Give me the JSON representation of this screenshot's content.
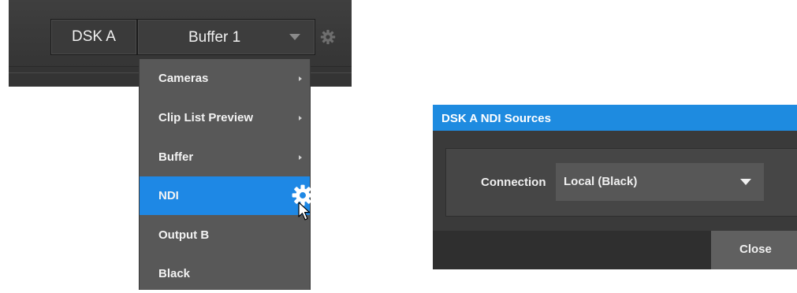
{
  "toolbar": {
    "dsk_label": "DSK A",
    "buffer_value": "Buffer 1",
    "settings_icon": "gear-icon"
  },
  "menu": {
    "items": [
      {
        "label": "Cameras",
        "has_submenu": true
      },
      {
        "label": "Clip List Preview",
        "has_submenu": true
      },
      {
        "label": "Buffer",
        "has_submenu": true
      },
      {
        "label": "NDI",
        "has_submenu": false,
        "selected": true,
        "icon": "gear-icon"
      },
      {
        "label": "Output B",
        "has_submenu": false
      },
      {
        "label": "Black",
        "has_submenu": false
      }
    ]
  },
  "dialog": {
    "title": "DSK A NDI Sources",
    "connection_label": "Connection",
    "connection_value": "Local (Black)",
    "close_label": "Close"
  },
  "colors": {
    "accent": "#1e88e5",
    "menu_bg": "#585858",
    "toolbar_bg": "#3a3a3a",
    "dialog_bg": "#3a3a3a"
  }
}
